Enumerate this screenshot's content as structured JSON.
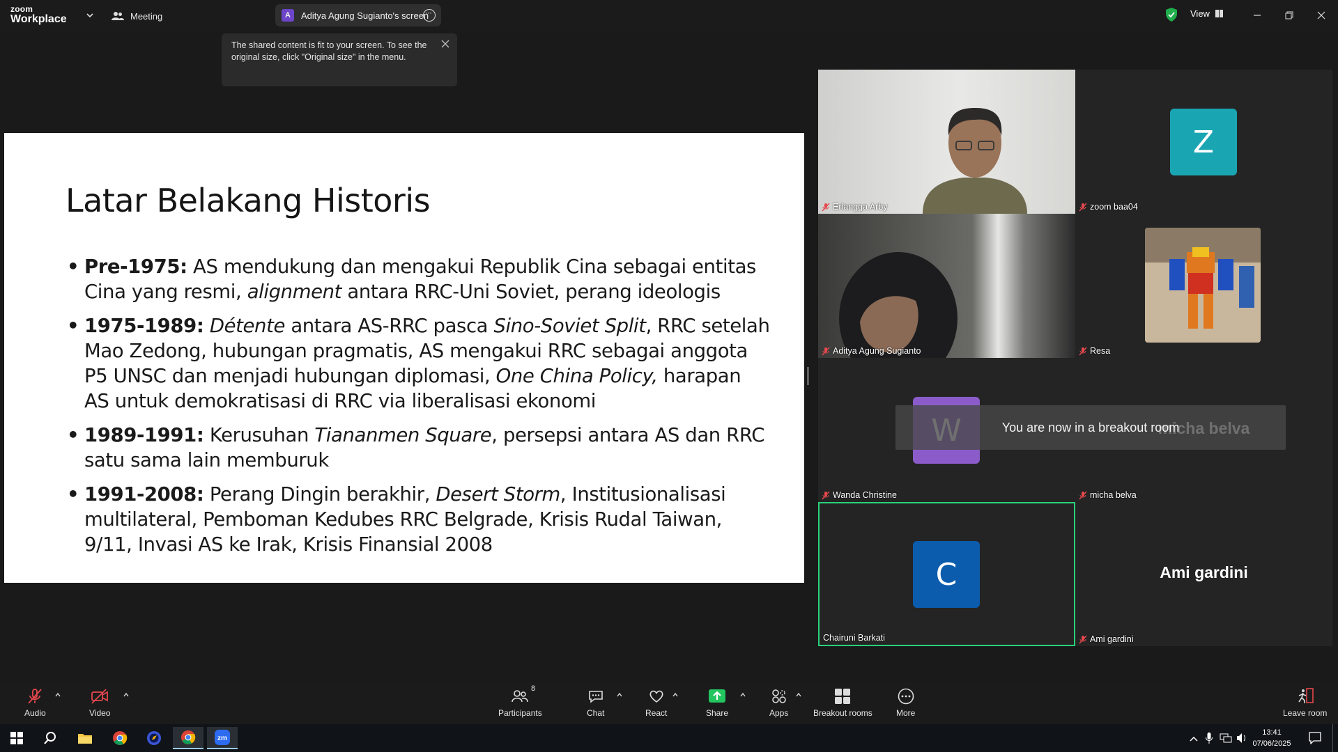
{
  "app": {
    "logo_line1": "zoom",
    "logo_line2": "Workplace",
    "meeting_label": "Meeting"
  },
  "share_indicator": {
    "avatar_letter": "A",
    "label": "Aditya Agung Sugianto's screen"
  },
  "top_right": {
    "view_label": "View"
  },
  "tooltip": {
    "text": "The shared content is fit to your screen. To see the original size, click \"Original size\" in the menu."
  },
  "slide": {
    "title": "Latar Belakang Historis",
    "bullets": [
      {
        "period": "Pre-1975:",
        "text": " AS mendukung dan mengakui Republik Cina sebagai entitas Cina yang resmi, ",
        "italic": "alignment",
        "text2": " antara RRC-Uni Soviet, perang ideologis"
      },
      {
        "period": "1975-1989:",
        "italic1": "Détente",
        "text1": " antara AS-RRC pasca ",
        "italic2": "Sino-Soviet Split",
        "text2": ", RRC setelah Mao Zedong, hubungan pragmatis, AS mengakui RRC sebagai anggota P5 UNSC dan menjadi hubungan diplomasi, ",
        "italic3": "One China Policy,",
        "text3": " harapan AS untuk demokratisasi di RRC via liberalisasi ekonomi"
      },
      {
        "period": "1989-1991:",
        "text1": " Kerusuhan ",
        "italic1": "Tiananmen Square",
        "text2": ", persepsi antara AS dan RRC satu sama lain memburuk"
      },
      {
        "period": "1991-2008:",
        "text1": " Perang Dingin berakhir, ",
        "italic1": "Desert Storm",
        "text2": ", Institusionalisasi multilateral, Pemboman Kedubes RRC Belgrade, Krisis Rudal Taiwan, 9/11, Invasi AS ke Irak, Krisis Finansial 2008"
      }
    ]
  },
  "participants": [
    {
      "name": "Erlangga Arby",
      "type": "video",
      "muted": true
    },
    {
      "name": "zoom baa04",
      "type": "avatar",
      "letter": "Z",
      "color": "#1aa5b3",
      "muted": true
    },
    {
      "name": "Aditya Agung Sugianto",
      "type": "video",
      "muted": true
    },
    {
      "name": "Resa",
      "type": "image",
      "muted": true
    },
    {
      "name": "Wanda Christine",
      "type": "avatar",
      "letter": "W",
      "color": "#8b5cc9",
      "muted": true
    },
    {
      "name": "micha belva",
      "type": "name",
      "display": "micha belva",
      "muted": true
    },
    {
      "name": "Chairuni Barkati",
      "type": "avatar",
      "letter": "C",
      "color": "#0b5cad",
      "muted": false,
      "active": true
    },
    {
      "name": "Ami gardini",
      "type": "name",
      "display": "Ami gardini",
      "muted": true
    }
  ],
  "toast": {
    "text": "You are now in a breakout room"
  },
  "toolbar": {
    "audio": "Audio",
    "video": "Video",
    "participants": "Participants",
    "participants_count": "8",
    "chat": "Chat",
    "react": "React",
    "share": "Share",
    "apps": "Apps",
    "breakout": "Breakout rooms",
    "more": "More",
    "leave": "Leave room"
  },
  "taskbar": {
    "time": "13:41",
    "date": "07/06/2025"
  },
  "colors": {
    "accent_green": "#29d27a",
    "share_green": "#22c55e",
    "video_off_red": "#e5484d"
  }
}
